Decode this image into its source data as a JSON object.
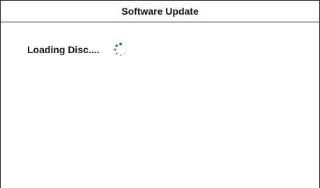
{
  "window": {
    "title": "Software Update"
  },
  "content": {
    "status_text": "Loading Disc....",
    "spinner_icon": "loading-spinner-icon",
    "accent_color": "#1e5fbf"
  }
}
